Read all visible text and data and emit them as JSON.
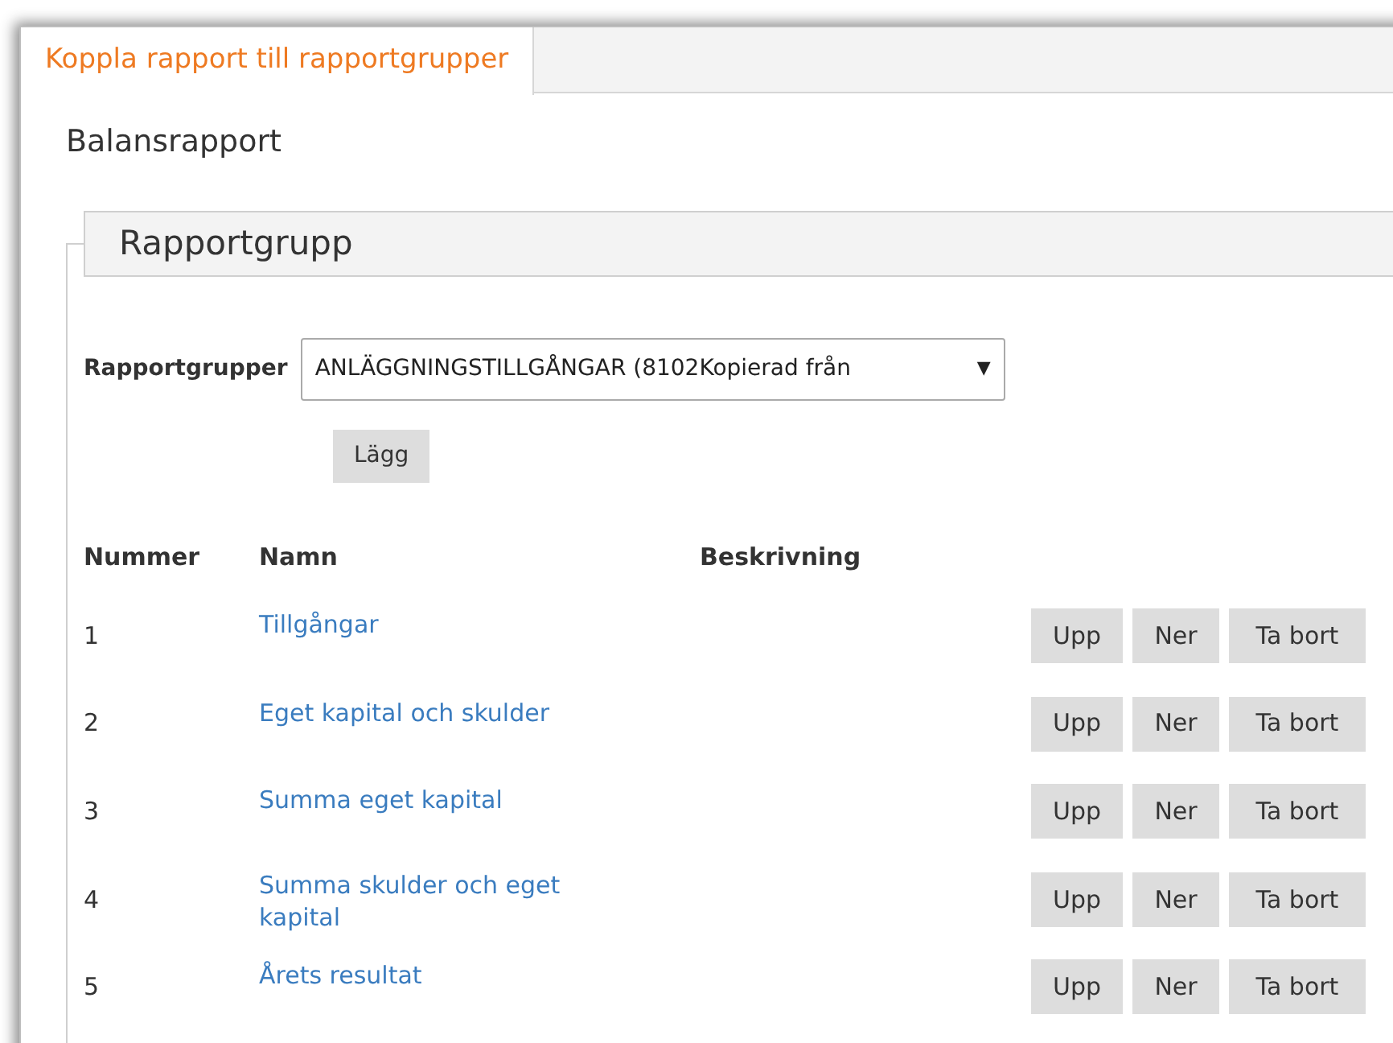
{
  "tabs": [
    {
      "label": "Koppla rapport till rapportgrupper",
      "selected": true
    }
  ],
  "report_name": "Balansrapport",
  "section": {
    "title": "Rapportgrupp",
    "group_select": {
      "label": "Rapportgrupper",
      "value": "ANLÄGGNINGSTILLGÅNGAR (8102Kopierad från",
      "arrow": "▼"
    },
    "add_button": "Lägg",
    "table": {
      "columns": [
        "Nummer",
        "Namn",
        "Beskrivning"
      ],
      "rows": [
        {
          "number": "1",
          "name": "Tillgångar",
          "actions": [
            "Upp",
            "Ner",
            "Ta bort"
          ]
        },
        {
          "number": "2",
          "name": "Eget kapital och skulder",
          "actions": [
            "Upp",
            "Ner",
            "Ta bort"
          ]
        },
        {
          "number": "3",
          "name": "Summa eget kapital",
          "actions": [
            "Upp",
            "Ner",
            "Ta bort"
          ]
        },
        {
          "number": "4",
          "name": "Summa skulder och eget kapital",
          "actions": [
            "Upp",
            "Ner",
            "Ta bort"
          ]
        },
        {
          "number": "5",
          "name": "Årets resultat",
          "actions": [
            "Upp",
            "Ner",
            "Ta bort"
          ]
        }
      ]
    }
  }
}
